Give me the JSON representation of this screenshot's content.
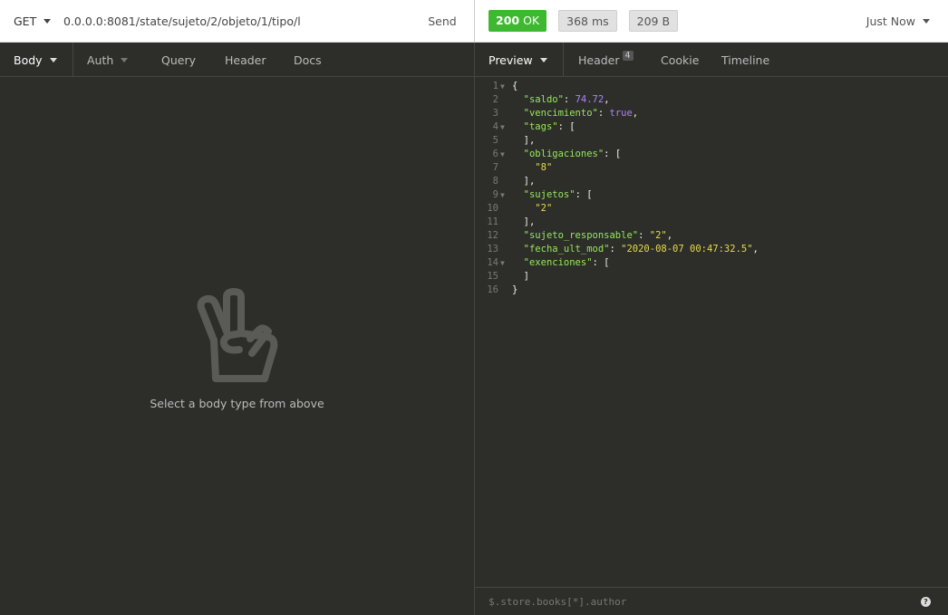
{
  "request": {
    "method": "GET",
    "url": "0.0.0.0:8081/state/sujeto/2/objeto/1/tipo/l",
    "send_label": "Send",
    "tabs": [
      {
        "label": "Body"
      },
      {
        "label": "Auth"
      },
      {
        "label": "Query"
      },
      {
        "label": "Header"
      },
      {
        "label": "Docs"
      }
    ],
    "empty_message": "Select a body type from above"
  },
  "response": {
    "status_code": "200",
    "status_text": "OK",
    "time": "368 ms",
    "size": "209 B",
    "history_label": "Just Now",
    "tabs": [
      {
        "label": "Preview"
      },
      {
        "label": "Header",
        "count": "4"
      },
      {
        "label": "Cookie"
      },
      {
        "label": "Timeline"
      }
    ],
    "filter_placeholder": "$.store.books[*].author",
    "lines": [
      {
        "n": "1",
        "fold": true,
        "tokens": [
          {
            "t": "txt",
            "v": "{"
          }
        ]
      },
      {
        "n": "2",
        "fold": false,
        "tokens": [
          {
            "t": "txt",
            "v": "  "
          },
          {
            "t": "key",
            "v": "\"saldo\""
          },
          {
            "t": "txt",
            "v": ": "
          },
          {
            "t": "num",
            "v": "74.72"
          },
          {
            "t": "txt",
            "v": ","
          }
        ]
      },
      {
        "n": "3",
        "fold": false,
        "tokens": [
          {
            "t": "txt",
            "v": "  "
          },
          {
            "t": "key",
            "v": "\"vencimiento\""
          },
          {
            "t": "txt",
            "v": ": "
          },
          {
            "t": "bool",
            "v": "true"
          },
          {
            "t": "txt",
            "v": ","
          }
        ]
      },
      {
        "n": "4",
        "fold": true,
        "tokens": [
          {
            "t": "txt",
            "v": "  "
          },
          {
            "t": "key",
            "v": "\"tags\""
          },
          {
            "t": "txt",
            "v": ": ["
          }
        ]
      },
      {
        "n": "5",
        "fold": false,
        "tokens": [
          {
            "t": "txt",
            "v": "  ],"
          }
        ]
      },
      {
        "n": "6",
        "fold": true,
        "tokens": [
          {
            "t": "txt",
            "v": "  "
          },
          {
            "t": "key",
            "v": "\"obligaciones\""
          },
          {
            "t": "txt",
            "v": ": ["
          }
        ]
      },
      {
        "n": "7",
        "fold": false,
        "tokens": [
          {
            "t": "txt",
            "v": "    "
          },
          {
            "t": "str",
            "v": "\"8\""
          }
        ]
      },
      {
        "n": "8",
        "fold": false,
        "tokens": [
          {
            "t": "txt",
            "v": "  ],"
          }
        ]
      },
      {
        "n": "9",
        "fold": true,
        "tokens": [
          {
            "t": "txt",
            "v": "  "
          },
          {
            "t": "key",
            "v": "\"sujetos\""
          },
          {
            "t": "txt",
            "v": ": ["
          }
        ]
      },
      {
        "n": "10",
        "fold": false,
        "tokens": [
          {
            "t": "txt",
            "v": "    "
          },
          {
            "t": "str",
            "v": "\"2\""
          }
        ]
      },
      {
        "n": "11",
        "fold": false,
        "tokens": [
          {
            "t": "txt",
            "v": "  ],"
          }
        ]
      },
      {
        "n": "12",
        "fold": false,
        "tokens": [
          {
            "t": "txt",
            "v": "  "
          },
          {
            "t": "key",
            "v": "\"sujeto_responsable\""
          },
          {
            "t": "txt",
            "v": ": "
          },
          {
            "t": "str",
            "v": "\"2\""
          },
          {
            "t": "txt",
            "v": ","
          }
        ]
      },
      {
        "n": "13",
        "fold": false,
        "tokens": [
          {
            "t": "txt",
            "v": "  "
          },
          {
            "t": "key",
            "v": "\"fecha_ult_mod\""
          },
          {
            "t": "txt",
            "v": ": "
          },
          {
            "t": "str",
            "v": "\"2020-08-07 00:47:32.5\""
          },
          {
            "t": "txt",
            "v": ","
          }
        ]
      },
      {
        "n": "14",
        "fold": true,
        "tokens": [
          {
            "t": "txt",
            "v": "  "
          },
          {
            "t": "key",
            "v": "\"exenciones\""
          },
          {
            "t": "txt",
            "v": ": ["
          }
        ]
      },
      {
        "n": "15",
        "fold": false,
        "tokens": [
          {
            "t": "txt",
            "v": "  ]"
          }
        ]
      },
      {
        "n": "16",
        "fold": false,
        "tokens": [
          {
            "t": "txt",
            "v": "}"
          }
        ]
      }
    ]
  },
  "icons": {
    "method_caret": "chevron-down-icon",
    "empty_state": "peace-hand-icon",
    "help": "question-circle-icon"
  },
  "colors": {
    "status_ok": "#3db830",
    "json_key": "#96e85a",
    "json_string": "#e5db4d",
    "json_number": "#ae81ff",
    "background": "#2d2e29"
  }
}
